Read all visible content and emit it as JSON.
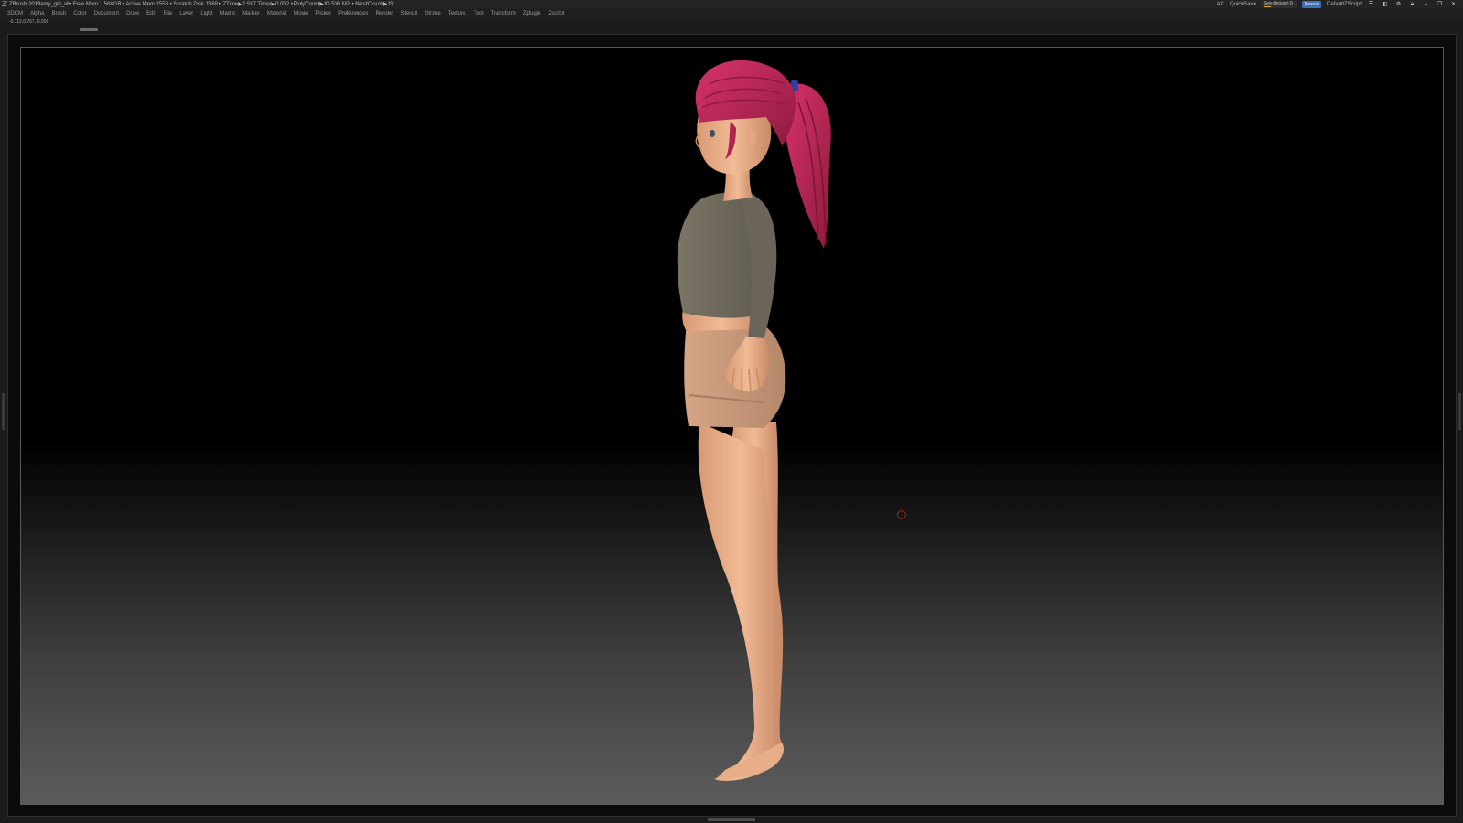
{
  "titlebar": {
    "app_name": "ZBrush 2019",
    "file_name": "amy_girl_v6",
    "stats": "• Free Mem 1.568GB • Active Mem 1558 • Scratch Disk 1368 •  ZTime▶2.537 Timer▶0.002 • PolyCount▶10.536 MP  • MeshCount▶13",
    "ac_label": "AC",
    "quicksave_label": "QuickSave",
    "see_through_label": "See-through  0",
    "menus_label": "Menus",
    "script_label": "DefaultZScript"
  },
  "menubar": {
    "items": [
      "3DCM",
      "Alpha",
      "Brush",
      "Color",
      "Document",
      "Draw",
      "Edit",
      "File",
      "Layer",
      "Light",
      "Macro",
      "Marker",
      "Material",
      "Movie",
      "Picker",
      "Preferences",
      "Render",
      "Stencil",
      "Stroke",
      "Texture",
      "Tool",
      "Transform",
      "Zplugin",
      "Zscript"
    ]
  },
  "status": {
    "coordinates": "-0.112,0.767,-0.009"
  },
  "colors": {
    "hair": "#c2285a",
    "skin": "#e9b08a",
    "shirt": "#6f6a5c",
    "shorts": "#c9997a",
    "accent": "#3c6fb5"
  }
}
